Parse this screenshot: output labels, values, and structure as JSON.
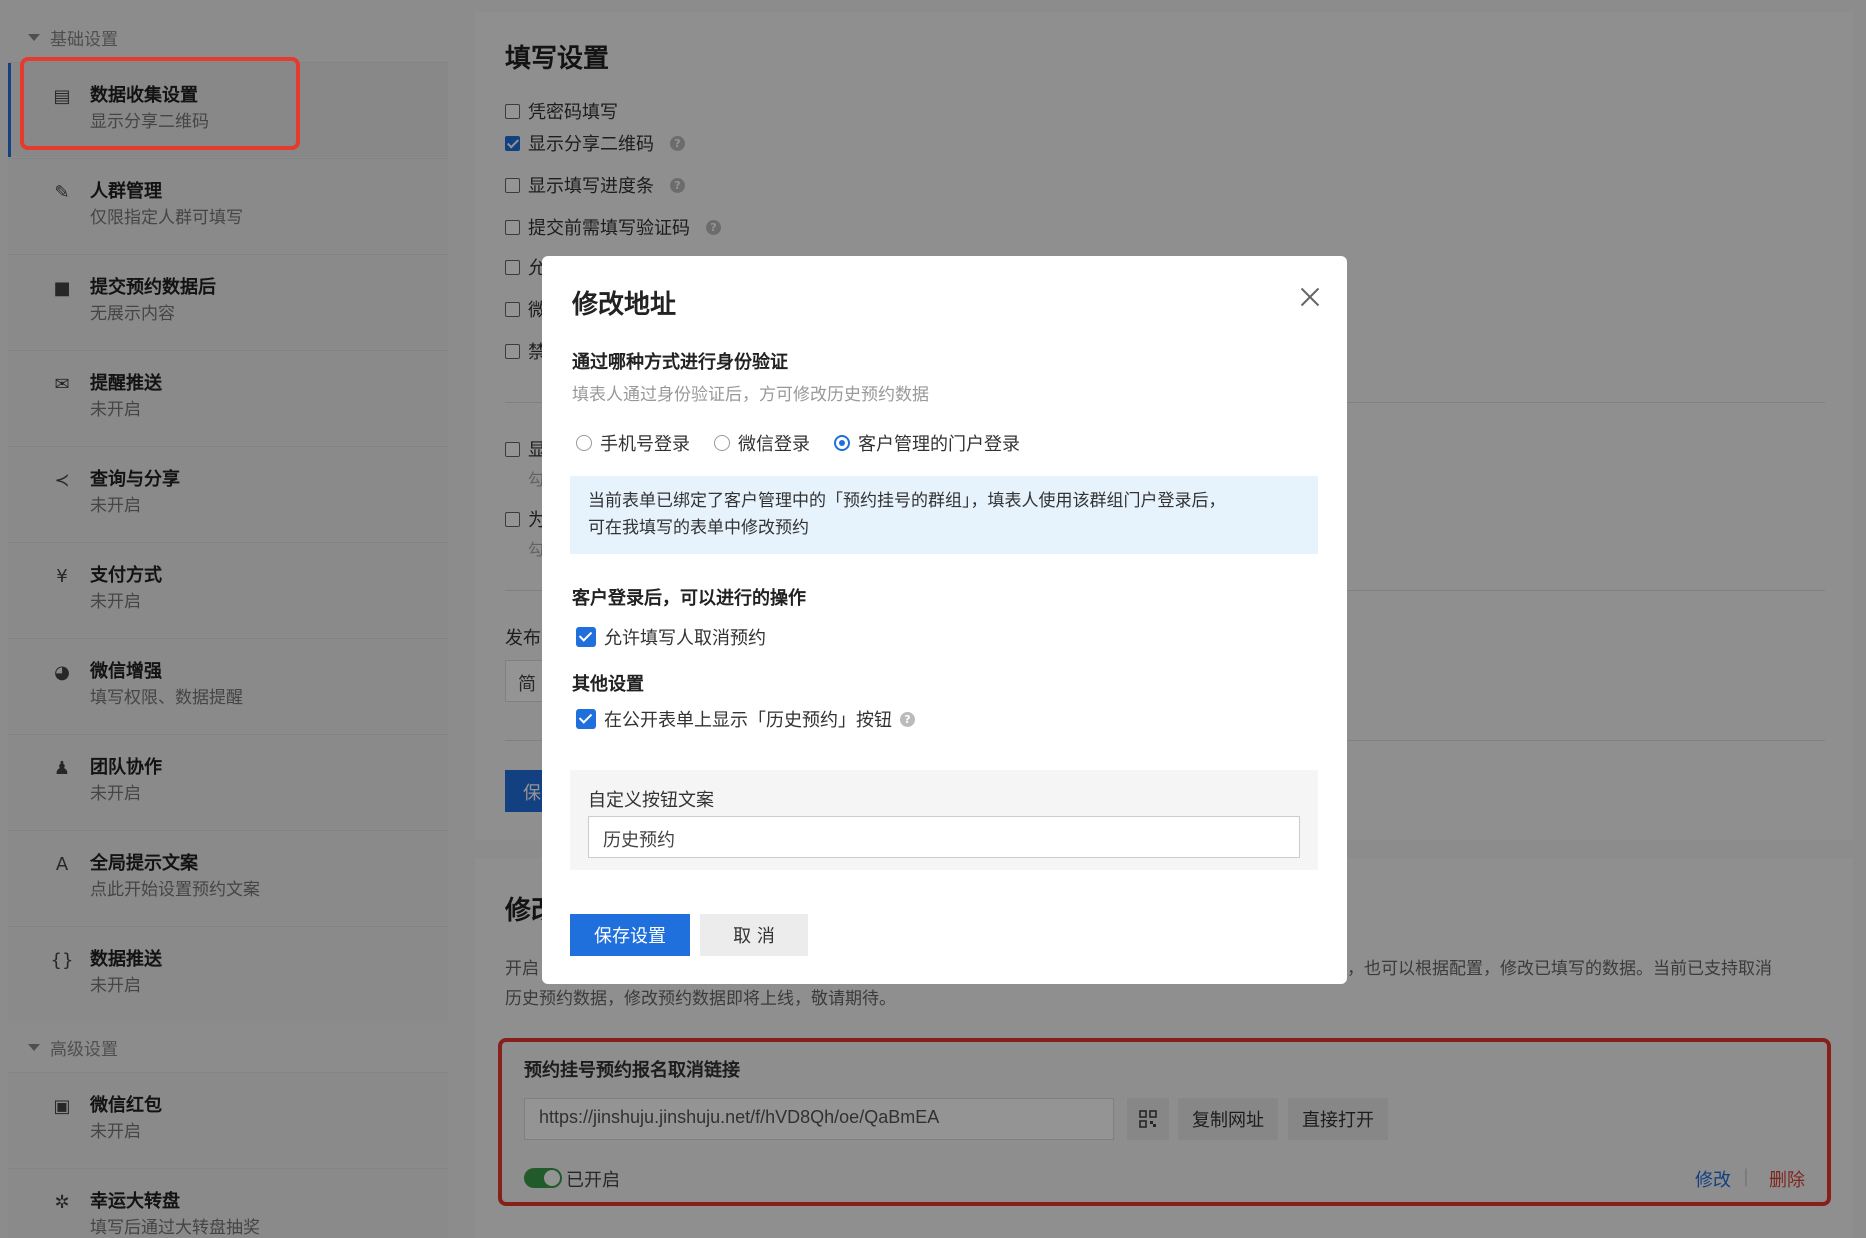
{
  "sidebar": {
    "basic_group": "基础设置",
    "advanced_group": "高级设置",
    "items": [
      {
        "title": "数据收集设置",
        "sub": "显示分享二维码",
        "icon": "document-icon"
      },
      {
        "title": "人群管理",
        "sub": "仅限指定人群可填写",
        "icon": "pen-icon"
      },
      {
        "title": "提交预约数据后",
        "sub": "无展示内容",
        "icon": "square-icon"
      },
      {
        "title": "提醒推送",
        "sub": "未开启",
        "icon": "envelope-icon"
      },
      {
        "title": "查询与分享",
        "sub": "未开启",
        "icon": "share-icon"
      },
      {
        "title": "支付方式",
        "sub": "未开启",
        "icon": "yen-icon"
      },
      {
        "title": "微信增强",
        "sub": "填写权限、数据提醒",
        "icon": "wechat-icon"
      },
      {
        "title": "团队协作",
        "sub": "未开启",
        "icon": "users-icon"
      },
      {
        "title": "全局提示文案",
        "sub": "点此开始设置预约文案",
        "icon": "font-icon"
      },
      {
        "title": "数据推送",
        "sub": "未开启",
        "icon": "code-icon"
      }
    ],
    "advanced_items": [
      {
        "title": "微信红包",
        "sub": "未开启",
        "icon": "redpacket-icon"
      },
      {
        "title": "幸运大转盘",
        "sub": "填写后通过大转盘抽奖",
        "icon": "wheel-icon"
      }
    ]
  },
  "fill_settings": {
    "title": "填写设置",
    "options": [
      {
        "label": "凭密码填写",
        "checked": false
      },
      {
        "label": "显示分享二维码",
        "checked": true
      },
      {
        "label": "显示填写进度条",
        "checked": false
      },
      {
        "label": "提交前需填写验证码",
        "checked": false
      },
      {
        "label": "允",
        "checked": false
      },
      {
        "label": "微",
        "checked": false
      },
      {
        "label": "禁",
        "checked": false
      }
    ],
    "more_options": [
      {
        "label": "显",
        "sub": "勾",
        "checked": false
      },
      {
        "label": "为",
        "sub": "勾",
        "checked": false
      }
    ],
    "publish_label": "发布",
    "publish_value": "简",
    "save_label": "保"
  },
  "modify_section": {
    "title": "修改",
    "desc_left": "开启",
    "desc_right": "，也可以根据配置，修改已填写的数据。当前已支持取消",
    "desc_line2": "历史预约数据，修改预约数据即将上线，敬请期待。",
    "link_box": {
      "title": "预约挂号预约报名取消链接",
      "url": "https://jinshuju.jinshuju.net/f/hVD8Qh/oe/QaBmEA",
      "copy_label": "复制网址",
      "open_label": "直接打开",
      "status": "已开启",
      "edit_label": "修改",
      "separator": "|",
      "delete_label": "删除"
    }
  },
  "modal": {
    "title": "修改地址",
    "auth_label": "通过哪种方式进行身份验证",
    "auth_sub": "填表人通过身份验证后，方可修改历史预约数据",
    "radios": [
      {
        "label": "手机号登录",
        "selected": false
      },
      {
        "label": "微信登录",
        "selected": false
      },
      {
        "label": "客户管理的门户登录",
        "selected": true
      }
    ],
    "info_line1": "当前表单已绑定了客户管理中的「预约挂号的群组」，填表人使用该群组门户登录后，",
    "info_line2": "可在我填写的表单中修改预约",
    "ops_label": "客户登录后，可以进行的操作",
    "ops_option": "允许填写人取消预约",
    "other_label": "其他设置",
    "other_option": "在公开表单上显示「历史预约」按钮",
    "custom_label": "自定义按钮文案",
    "custom_value": "历史预约",
    "save_label": "保存设置",
    "cancel_label": "取 消"
  },
  "colors": {
    "primary": "#1f6fdc",
    "highlight": "#e53a2e",
    "toggle_on": "#3a9b4a",
    "danger": "#d9433a",
    "info_bg": "#e6f2fc"
  }
}
